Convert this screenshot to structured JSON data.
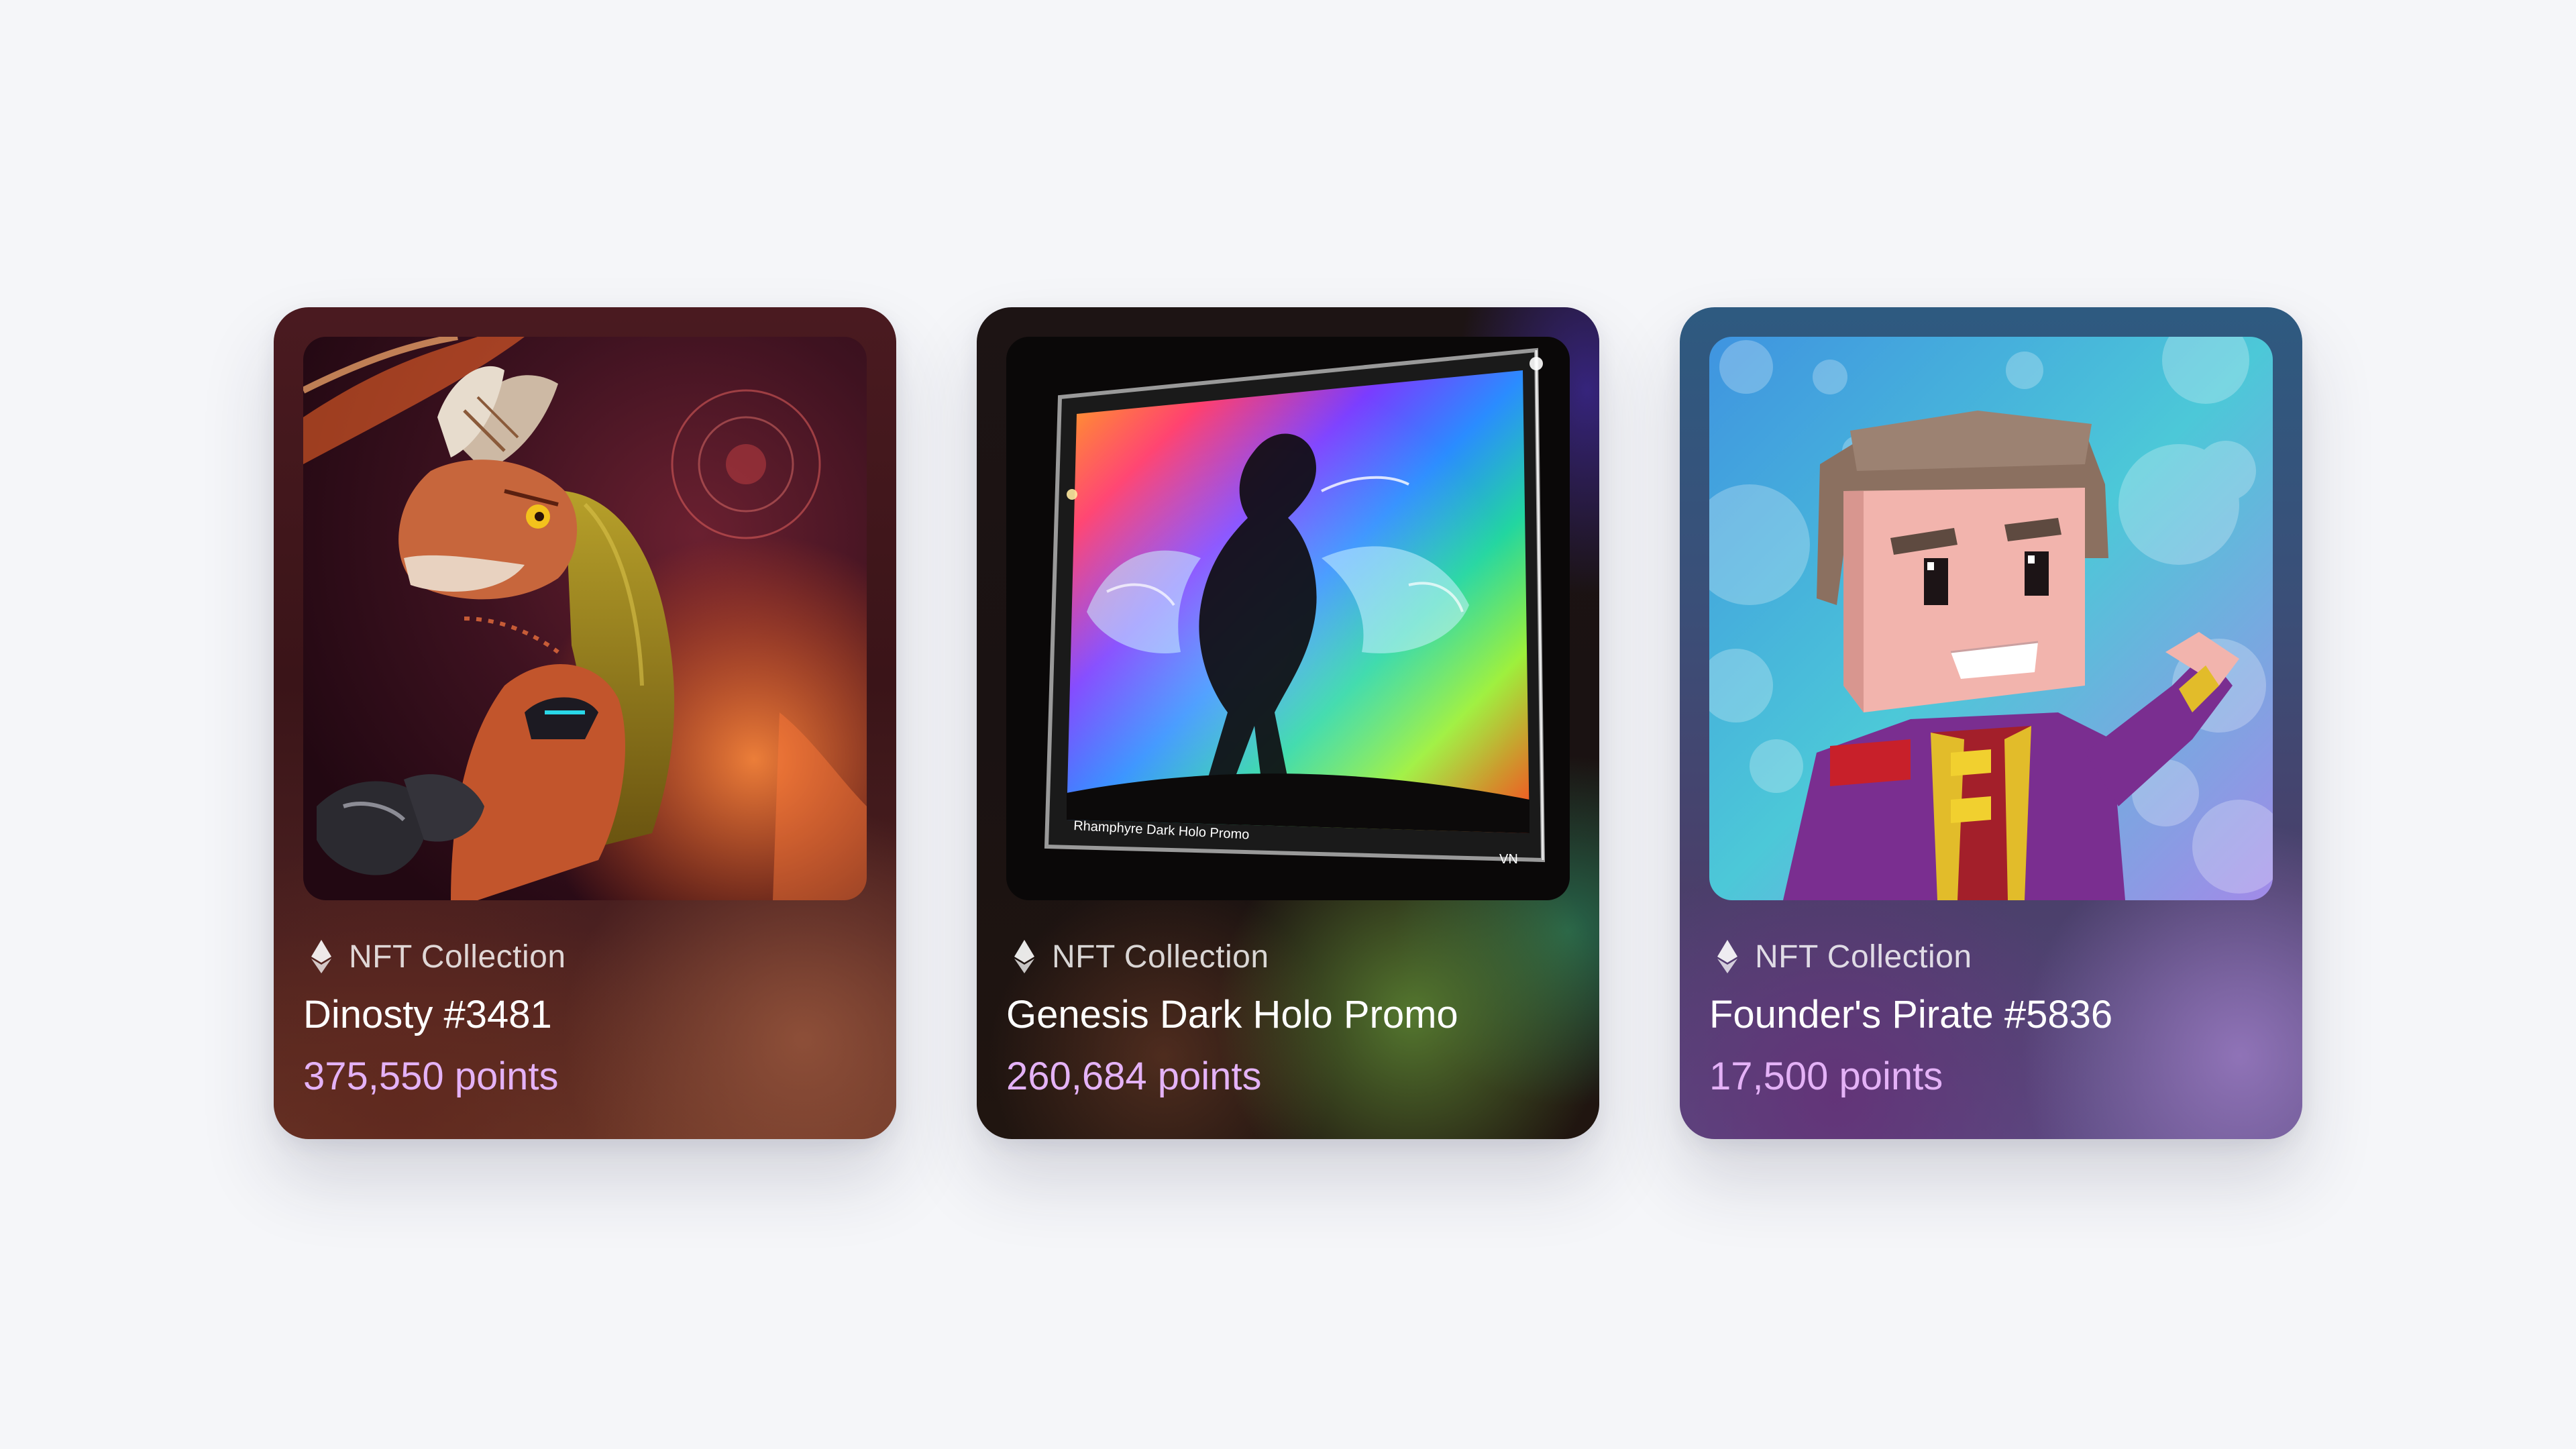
{
  "cards": [
    {
      "collection_label": "NFT Collection",
      "chain_icon": "ethereum-icon",
      "title": "Dinosty #3481",
      "points": "375,550 points",
      "art": "dinosaur-portrait"
    },
    {
      "collection_label": "NFT Collection",
      "chain_icon": "ethereum-icon",
      "title": "Genesis Dark Holo Promo",
      "points": "260,684 points",
      "art": "holographic-dragon-frame",
      "art_caption": "Rhamphyre Dark Holo Promo",
      "art_corner": "VN"
    },
    {
      "collection_label": "NFT Collection",
      "chain_icon": "ethereum-icon",
      "title": "Founder's Pirate #5836",
      "points": "17,500 points",
      "art": "voxel-pirate-avatar"
    }
  ],
  "colors": {
    "page_background": "#f5f6f9",
    "points_text": "#e4b2f7",
    "title_text": "#ffffff"
  }
}
